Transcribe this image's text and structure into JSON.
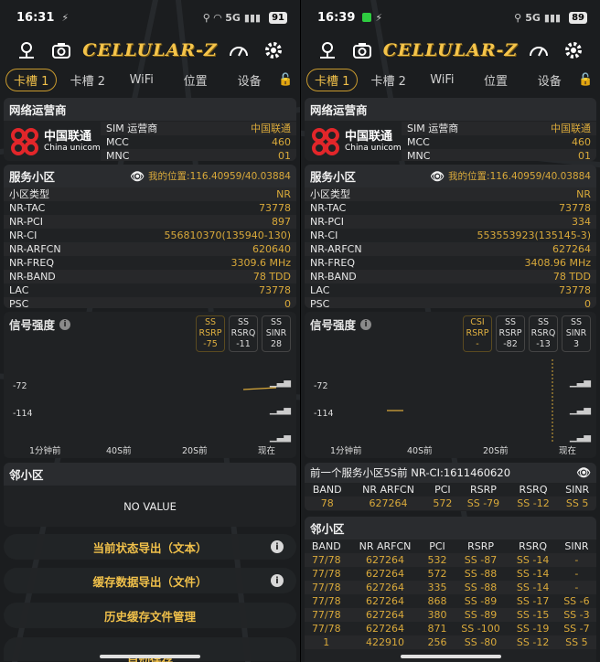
{
  "left": {
    "status": {
      "time": "16:31",
      "net": "5G",
      "battery": "91"
    },
    "header": {
      "logo": "CELLULAR-Z"
    },
    "tabs": [
      "卡槽 1",
      "卡槽 2",
      "WiFi",
      "位置",
      "设备"
    ],
    "operator": {
      "title": "网络运营商",
      "logo_cn": "中国联通",
      "logo_en": "China unicom",
      "rows": [
        {
          "k": "SIM 运营商",
          "v": "中国联通"
        },
        {
          "k": "MCC",
          "v": "460"
        },
        {
          "k": "MNC",
          "v": "01"
        }
      ]
    },
    "cell": {
      "title": "服务小区",
      "location": "我的位置:116.40959/40.03884",
      "rows": [
        {
          "k": "小区类型",
          "v": "NR"
        },
        {
          "k": "NR-TAC",
          "v": "73778"
        },
        {
          "k": "NR-PCI",
          "v": "897"
        },
        {
          "k": "NR-CI",
          "v": "556810370(135940-130)"
        },
        {
          "k": "NR-ARFCN",
          "v": "620640"
        },
        {
          "k": "NR-FREQ",
          "v": "3309.6 MHz"
        },
        {
          "k": "NR-BAND",
          "v": "78 TDD"
        },
        {
          "k": "LAC",
          "v": "73778"
        },
        {
          "k": "PSC",
          "v": "0"
        }
      ]
    },
    "signal": {
      "title": "信号强度",
      "metrics": [
        {
          "a": "SS",
          "b": "RSRP",
          "v": "-75",
          "on": true
        },
        {
          "a": "SS",
          "b": "RSRQ",
          "v": "-11",
          "on": false
        },
        {
          "a": "SS",
          "b": "SINR",
          "v": "28",
          "on": false
        }
      ],
      "yticks": [
        "-72",
        "-114"
      ],
      "xticks": [
        "1分钟前",
        "40S前",
        "20S前",
        "现在"
      ]
    },
    "neighbor": {
      "title": "邻小区",
      "empty": "NO VALUE"
    },
    "buttons": [
      "当前状态导出（文本）",
      "缓存数据导出（文件）",
      "历史缓存文件管理",
      "自动保存"
    ]
  },
  "right": {
    "status": {
      "time": "16:39",
      "net": "5G",
      "battery": "89"
    },
    "header": {
      "logo": "CELLULAR-Z"
    },
    "tabs": [
      "卡槽 1",
      "卡槽 2",
      "WiFi",
      "位置",
      "设备"
    ],
    "operator": {
      "title": "网络运营商",
      "logo_cn": "中国联通",
      "logo_en": "China unicom",
      "rows": [
        {
          "k": "SIM 运营商",
          "v": "中国联通"
        },
        {
          "k": "MCC",
          "v": "460"
        },
        {
          "k": "MNC",
          "v": "01"
        }
      ]
    },
    "cell": {
      "title": "服务小区",
      "location": "我的位置:116.40959/40.03884",
      "rows": [
        {
          "k": "小区类型",
          "v": "NR"
        },
        {
          "k": "NR-TAC",
          "v": "73778"
        },
        {
          "k": "NR-PCI",
          "v": "334"
        },
        {
          "k": "NR-CI",
          "v": "553553923(135145-3)"
        },
        {
          "k": "NR-ARFCN",
          "v": "627264"
        },
        {
          "k": "NR-FREQ",
          "v": "3408.96 MHz"
        },
        {
          "k": "NR-BAND",
          "v": "78 TDD"
        },
        {
          "k": "LAC",
          "v": "73778"
        },
        {
          "k": "PSC",
          "v": "0"
        }
      ]
    },
    "signal": {
      "title": "信号强度",
      "metrics": [
        {
          "a": "CSI",
          "b": "RSRP",
          "v": "-",
          "on": true
        },
        {
          "a": "SS",
          "b": "RSRP",
          "v": "-82",
          "on": false
        },
        {
          "a": "SS",
          "b": "RSRQ",
          "v": "-13",
          "on": false
        },
        {
          "a": "SS",
          "b": "SINR",
          "v": "3",
          "on": false
        }
      ],
      "yticks": [
        "-72",
        "-114"
      ],
      "xticks": [
        "1分钟前",
        "40S前",
        "20S前",
        "现在"
      ]
    },
    "previous": {
      "title": "前一个服务小区5S前 NR-CI:1611460620",
      "headers": [
        "BAND",
        "NR ARFCN",
        "PCI",
        "RSRP",
        "RSRQ",
        "SINR"
      ],
      "rows": [
        [
          "78",
          "627264",
          "572",
          "SS -79",
          "SS -12",
          "SS 5"
        ]
      ]
    },
    "neighbor": {
      "title": "邻小区",
      "headers": [
        "BAND",
        "NR ARFCN",
        "PCI",
        "RSRP",
        "RSRQ",
        "SINR"
      ],
      "rows": [
        [
          "77/78",
          "627264",
          "532",
          "SS -87",
          "SS -14",
          "-"
        ],
        [
          "77/78",
          "627264",
          "572",
          "SS -88",
          "SS -14",
          "-"
        ],
        [
          "77/78",
          "627264",
          "335",
          "SS -88",
          "SS -14",
          "-"
        ],
        [
          "77/78",
          "627264",
          "868",
          "SS -89",
          "SS -17",
          "SS -6"
        ],
        [
          "77/78",
          "627264",
          "380",
          "SS -89",
          "SS -15",
          "SS -3"
        ],
        [
          "77/78",
          "627264",
          "871",
          "SS -100",
          "SS -19",
          "SS -7"
        ],
        [
          "1",
          "422910",
          "256",
          "SS -80",
          "SS -12",
          "SS 5"
        ]
      ]
    }
  }
}
